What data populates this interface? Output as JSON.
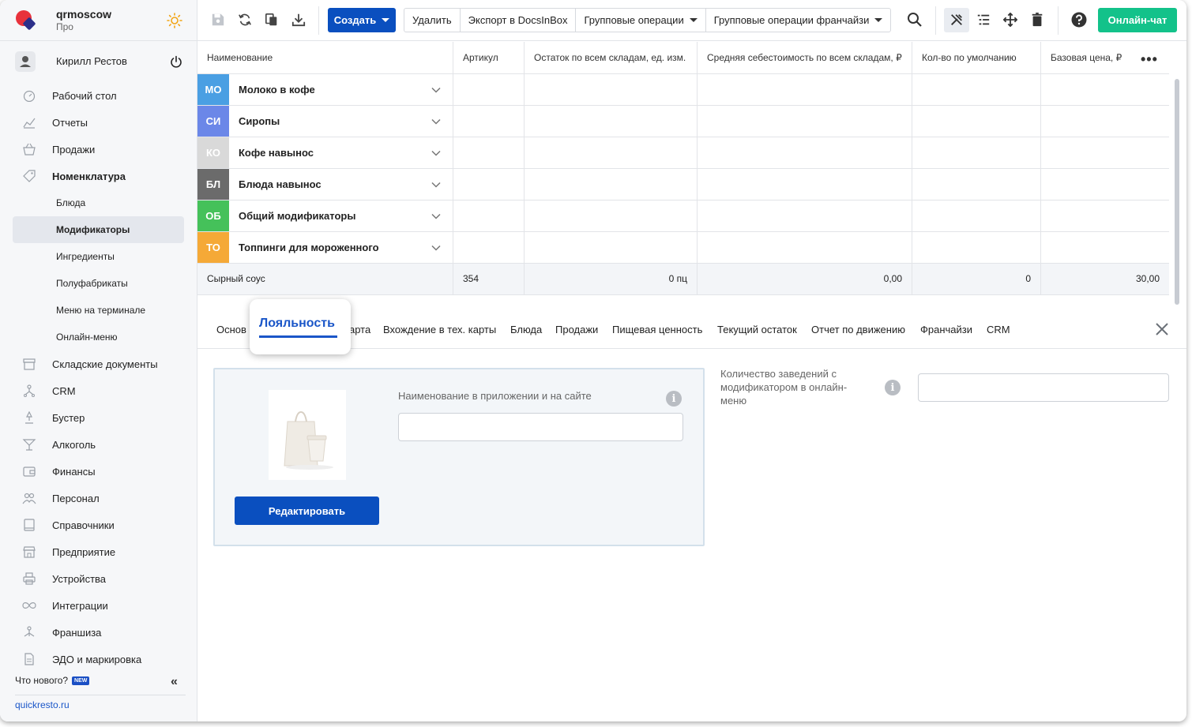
{
  "brand": {
    "name": "qrmoscow",
    "plan": "Про"
  },
  "user": {
    "name": "Кирилл Рестов"
  },
  "sidebar": {
    "items": [
      {
        "label": "Рабочий стол",
        "icon": "dashboard-icon"
      },
      {
        "label": "Отчеты",
        "icon": "reports-icon"
      },
      {
        "label": "Продажи",
        "icon": "basket-icon"
      },
      {
        "label": "Номенклатура",
        "icon": "tag-icon",
        "bold": true
      },
      {
        "label": "Блюда",
        "sub": true
      },
      {
        "label": "Модификаторы",
        "sub": true,
        "active": true
      },
      {
        "label": "Ингредиенты",
        "sub": true
      },
      {
        "label": "Полуфабрикаты",
        "sub": true
      },
      {
        "label": "Меню на терминале",
        "sub": true
      },
      {
        "label": "Онлайн-меню",
        "sub": true
      },
      {
        "label": "Складские документы",
        "icon": "archive-icon"
      },
      {
        "label": "CRM",
        "icon": "crm-icon"
      },
      {
        "label": "Бустер",
        "icon": "booster-icon"
      },
      {
        "label": "Алкоголь",
        "icon": "cocktail-icon"
      },
      {
        "label": "Финансы",
        "icon": "wallet-icon"
      },
      {
        "label": "Персонал",
        "icon": "people-icon"
      },
      {
        "label": "Справочники",
        "icon": "book-icon"
      },
      {
        "label": "Предприятие",
        "icon": "store-icon"
      },
      {
        "label": "Устройства",
        "icon": "printer-icon"
      },
      {
        "label": "Интеграции",
        "icon": "infinity-icon"
      },
      {
        "label": "Франшиза",
        "icon": "franchise-icon"
      },
      {
        "label": "ЭДО и маркировка",
        "icon": "document-icon"
      }
    ],
    "whats_new": "Что нового?",
    "new_badge": "NEW",
    "collapse": "«",
    "site_link": "quickresto.ru"
  },
  "toolbar": {
    "create": "Создать",
    "actions": [
      "Удалить",
      "Экспорт в DocsInBox",
      "Групповые операции",
      "Групповые операции франчайзи"
    ],
    "chat": "Онлайн-чат"
  },
  "table": {
    "columns": [
      "Наименование",
      "Артикул",
      "Остаток по всем складам, ед. изм.",
      "Средняя себестоимость по всем складам, ₽",
      "Кол-во по умолчанию",
      "Базовая цена, ₽"
    ],
    "more": "•••",
    "groups": [
      {
        "abbr": "МО",
        "name": "Молоко в кофе",
        "color": "#4a9fe3"
      },
      {
        "abbr": "СИ",
        "name": "Сиропы",
        "color": "#6b87e8"
      },
      {
        "abbr": "КО",
        "name": "Кофе навынос",
        "color": "#d9d9d9"
      },
      {
        "abbr": "БЛ",
        "name": "Блюда навынос",
        "color": "#6b6b6b"
      },
      {
        "abbr": "ОБ",
        "name": "Общий модификаторы",
        "color": "#45c15a"
      },
      {
        "abbr": "ТО",
        "name": "Топпинги для мороженного",
        "color": "#f5a937"
      }
    ],
    "selected_row": {
      "name": "Сырный соус",
      "article": "354",
      "stock": "0 пц",
      "cost": "0,00",
      "qty": "0",
      "price": "30,00"
    }
  },
  "tabs": {
    "items": [
      "Основ",
      "арта",
      "Вхождение в тех. карты",
      "Блюда",
      "Продажи",
      "Пищевая ценность",
      "Текущий остаток",
      "Отчет по движению",
      "Франчайзи",
      "CRM"
    ],
    "active": "Лояльность"
  },
  "detail": {
    "edit_button": "Редактировать",
    "app_name_label": "Наименование в приложении и на сайте",
    "app_name_value": "",
    "count_label": "Количество заведений с модификатором в онлайн-меню",
    "count_value": "",
    "info_glyph": "i"
  }
}
